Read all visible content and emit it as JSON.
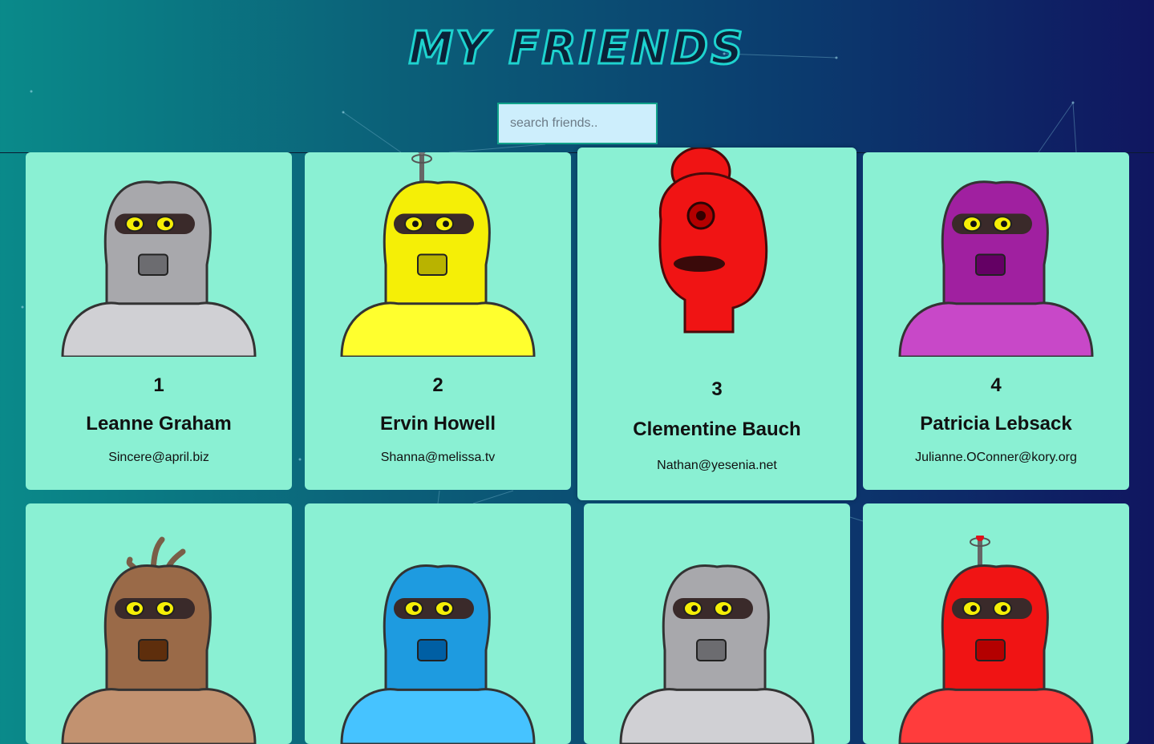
{
  "header": {
    "title": "MY FRIENDS",
    "search_placeholder": "search friends.."
  },
  "colors": {
    "card_bg": "#8af0d3",
    "title_outline": "#1ed3cf",
    "search_bg": "#cdeefc"
  },
  "friends": [
    {
      "id": "1",
      "name": "Leanne Graham",
      "email": "Sincere@april.biz",
      "robot_color": "#a8a8ac",
      "robot_icon": "knight-robot-icon"
    },
    {
      "id": "2",
      "name": "Ervin Howell",
      "email": "Shanna@melissa.tv",
      "robot_color": "#f5ef06",
      "robot_icon": "antenna-robot-icon"
    },
    {
      "id": "3",
      "name": "Clementine Bauch",
      "email": "Nathan@yesenia.net",
      "robot_color": "#f01414",
      "robot_icon": "cyclops-robot-icon"
    },
    {
      "id": "4",
      "name": "Patricia Lebsack",
      "email": "Julianne.OConner@kory.org",
      "robot_color": "#a020a0",
      "robot_icon": "egg-robot-icon"
    },
    {
      "robot_color": "#9a6a48",
      "robot_icon": "sprout-robot-icon"
    },
    {
      "robot_color": "#1e9be0",
      "robot_icon": "visor-robot-icon"
    },
    {
      "robot_color": "#a8a8ac",
      "robot_icon": "helmet-robot-icon"
    },
    {
      "robot_color": "#f01414",
      "robot_icon": "antenna-robot-icon"
    }
  ]
}
